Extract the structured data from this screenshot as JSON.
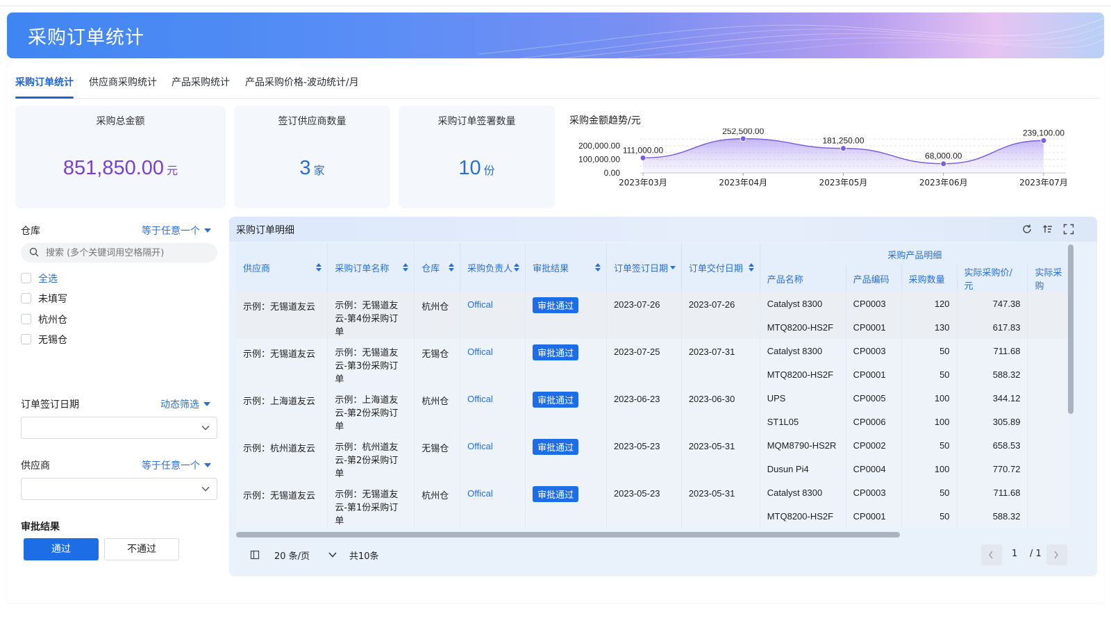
{
  "banner": {
    "title": "采购订单统计"
  },
  "tabs": [
    {
      "label": "采购订单统计",
      "active": true
    },
    {
      "label": "供应商采购统计"
    },
    {
      "label": "产品采购统计"
    },
    {
      "label": "产品采购价格-波动统计/月"
    }
  ],
  "stats": {
    "total_amount": {
      "label": "采购总金额",
      "value": "851,850.00",
      "unit": "元",
      "color": "#7b3fd6"
    },
    "supplier_count": {
      "label": "签订供应商数量",
      "value": "3",
      "unit": "家",
      "color": "#2a6fd8"
    },
    "order_count": {
      "label": "采购订单签署数量",
      "value": "10",
      "unit": "份",
      "color": "#2a6fd8"
    }
  },
  "trend": {
    "title": "采购金额趋势/元",
    "chart_data": {
      "type": "area",
      "categories": [
        "2023年03月",
        "2023年04月",
        "2023年05月",
        "2023年06月",
        "2023年07月"
      ],
      "values": [
        111000.0,
        252500.0,
        181250.0,
        68000.0,
        239100.0
      ],
      "value_labels": [
        "111,000.00",
        "252,500.00",
        "181,250.00",
        "68,000.00",
        "239,100.00"
      ],
      "y_ticks": [
        "0.00",
        "100,000.00",
        "200,000.00"
      ],
      "y_tick_values": [
        0,
        100000,
        200000
      ],
      "ylim": [
        0,
        200000
      ],
      "color": "#7b5ce8",
      "grid": true
    }
  },
  "filters": {
    "warehouse": {
      "title": "仓库",
      "operator": "等于任意一个",
      "search_placeholder": "搜索 (多个关键词用空格隔开)",
      "options": [
        "全选",
        "未填写",
        "杭州仓",
        "无锡仓"
      ]
    },
    "sign_date": {
      "title": "订单签订日期",
      "operator": "动态筛选"
    },
    "supplier": {
      "title": "供应商",
      "operator": "等于任意一个"
    },
    "approval": {
      "title": "审批结果",
      "pass_label": "通过",
      "fail_label": "不通过"
    }
  },
  "detail": {
    "title": "采购订单明细",
    "group_header": "采购产品明细",
    "columns": [
      "供应商",
      "采购订单名称",
      "仓库",
      "采购负责人",
      "审批结果",
      "订单签订日期",
      "订单交付日期"
    ],
    "sub_columns": [
      "产品名称",
      "产品编码",
      "采购数量",
      "实际采购价/元",
      "实际采购"
    ],
    "rows": [
      {
        "supplier": "示例：无锡道友云",
        "order_name": "示例：无锡道友云-第4份采购订单",
        "warehouse": "杭州仓",
        "owner": "Offical",
        "approval": "审批通过",
        "sign_date": "2023-07-26",
        "delivery_date": "2023-07-26",
        "items": [
          {
            "name": "Catalyst 8300",
            "code": "CP0003",
            "qty": "120",
            "price": "747.38"
          },
          {
            "name": "MTQ8200-HS2F",
            "code": "CP0001",
            "qty": "130",
            "price": "617.83"
          }
        ]
      },
      {
        "supplier": "示例：无锡道友云",
        "order_name": "示例：无锡道友云-第3份采购订单",
        "warehouse": "无锡仓",
        "owner": "Offical",
        "approval": "审批通过",
        "sign_date": "2023-07-25",
        "delivery_date": "2023-07-31",
        "items": [
          {
            "name": "Catalyst 8300",
            "code": "CP0003",
            "qty": "50",
            "price": "711.68"
          },
          {
            "name": "MTQ8200-HS2F",
            "code": "CP0001",
            "qty": "50",
            "price": "588.32"
          }
        ]
      },
      {
        "supplier": "示例：上海道友云",
        "order_name": "示例：上海道友云-第2份采购订单",
        "warehouse": "杭州仓",
        "owner": "Offical",
        "approval": "审批通过",
        "sign_date": "2023-06-23",
        "delivery_date": "2023-06-30",
        "items": [
          {
            "name": "UPS",
            "code": "CP0005",
            "qty": "100",
            "price": "344.12"
          },
          {
            "name": "ST1L05",
            "code": "CP0006",
            "qty": "100",
            "price": "305.89"
          }
        ]
      },
      {
        "supplier": "示例：杭州道友云",
        "order_name": "示例：杭州道友云-第2份采购订单",
        "warehouse": "无锡仓",
        "owner": "Offical",
        "approval": "审批通过",
        "sign_date": "2023-05-23",
        "delivery_date": "2023-05-31",
        "items": [
          {
            "name": "MQM8790-HS2R",
            "code": "CP0002",
            "qty": "50",
            "price": "658.53"
          },
          {
            "name": "Dusun Pi4",
            "code": "CP0004",
            "qty": "100",
            "price": "770.72"
          }
        ]
      },
      {
        "supplier": "示例：无锡道友云",
        "order_name": "示例：无锡道友云-第1份采购订单",
        "warehouse": "杭州仓",
        "owner": "Offical",
        "approval": "审批通过",
        "sign_date": "2023-05-23",
        "delivery_date": "2023-05-31",
        "items": [
          {
            "name": "Catalyst 8300",
            "code": "CP0003",
            "qty": "50",
            "price": "711.68"
          },
          {
            "name": "MTQ8200-HS2F",
            "code": "CP0001",
            "qty": "50",
            "price": "588.32"
          }
        ]
      }
    ],
    "pagination": {
      "page_size": "20 条/页",
      "total": "共10条",
      "current": "1",
      "of": "/ 1"
    }
  }
}
